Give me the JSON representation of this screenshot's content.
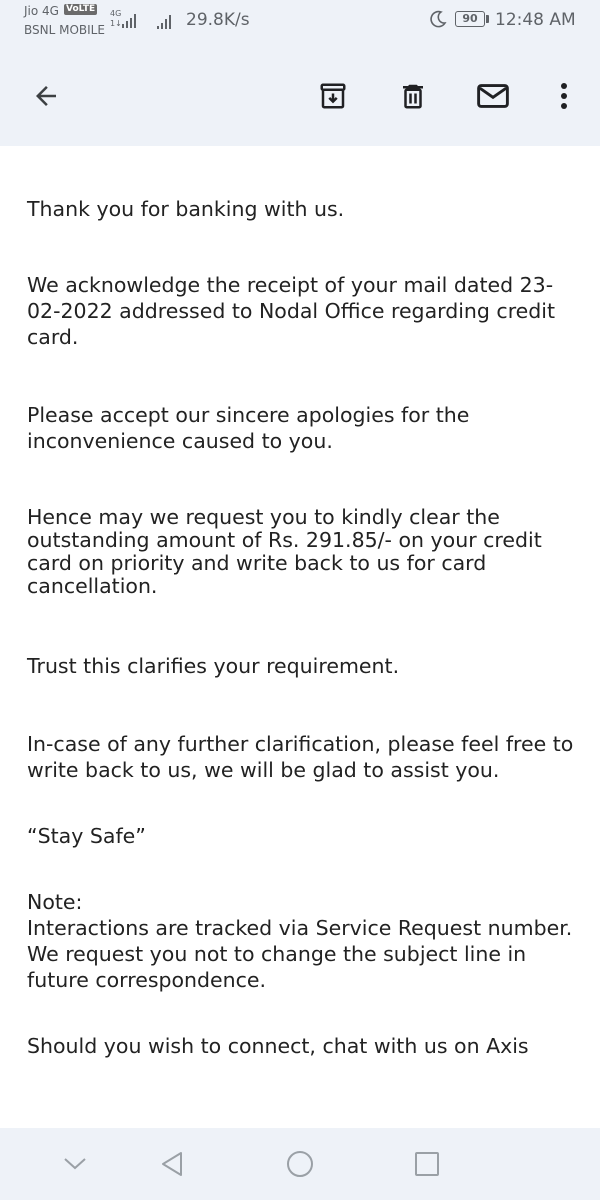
{
  "status_bar": {
    "carrier_primary": "Jio 4G",
    "volte_badge": "VoLTE",
    "carrier_secondary": "BSNL MOBILE",
    "network_type": "4G",
    "network_sub": "1↓",
    "speed": "29.8K/s",
    "battery": "90",
    "time": "12:48 AM"
  },
  "toolbar": {
    "back": "back-arrow-icon",
    "archive": "archive-icon",
    "delete": "delete-icon",
    "mark_unread": "mail-icon",
    "more": "more-vert-icon"
  },
  "email": {
    "paragraphs": [
      "Thank you for banking with us.",
      "We acknowledge the receipt of your mail dated 23-02-2022 addressed to Nodal Office regarding credit card.",
      "Please accept our sincere apologies for the inconvenience caused to you.",
      "Hence may we request you to kindly clear the outstanding amount of Rs. 291.85/- on your credit card on priority and write back to us for card cancellation.",
      "Trust this clarifies your requirement.",
      "In-case of any further clarification, please feel free to write back to us, we will be glad to assist you.",
      "“Stay Safe”",
      "Note:",
      "Interactions are tracked via Service Request number. We request you not to change the subject line in future correspondence.",
      "Should you wish to connect, chat with us on Axis"
    ]
  },
  "nav_bar": {
    "collapse": "chevron-down-icon",
    "back": "nav-back-icon",
    "home": "home-circle-icon",
    "recents": "recents-square-icon"
  }
}
